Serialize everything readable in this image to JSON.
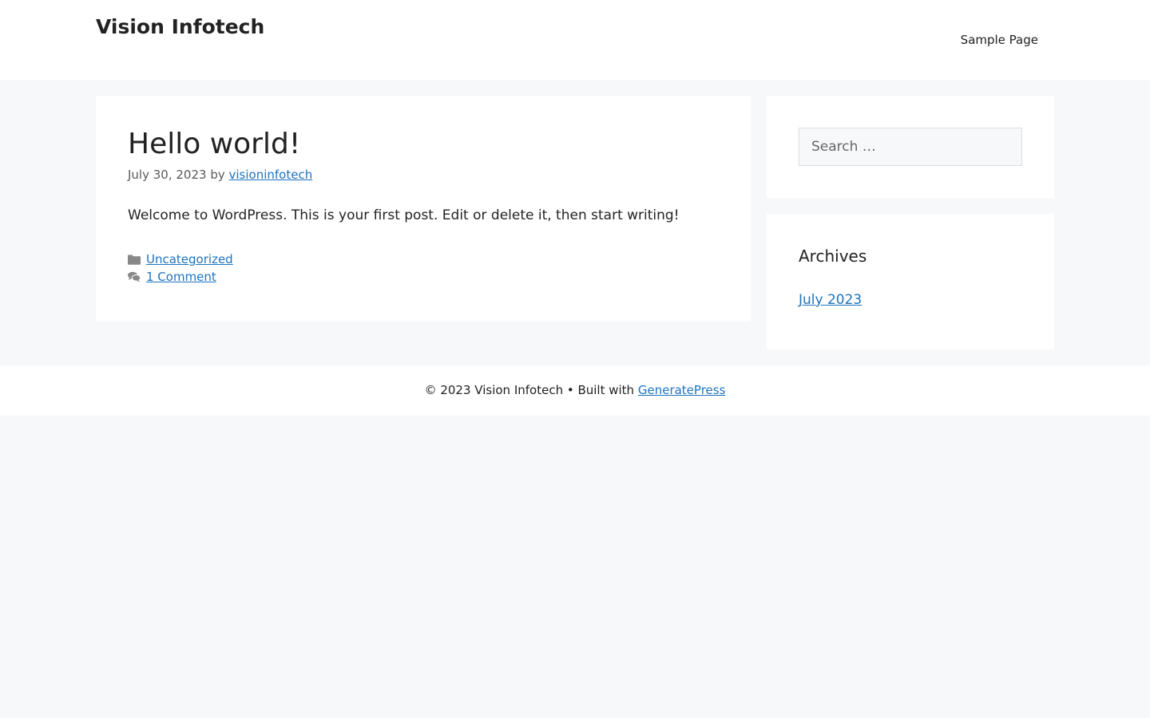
{
  "header": {
    "site_title": "Vision Infotech",
    "nav": [
      {
        "label": "Sample Page"
      }
    ]
  },
  "post": {
    "title": "Hello world!",
    "date": "July 30, 2023",
    "by_text": "by",
    "author": "visioninfotech",
    "content": "Welcome to WordPress. This is your first post. Edit or delete it, then start writing!",
    "category": "Uncategorized",
    "comments": "1 Comment",
    "icons": {
      "category": "folder-icon",
      "comments": "comments-icon"
    }
  },
  "sidebar": {
    "search": {
      "placeholder": "Search …"
    },
    "archives": {
      "title": "Archives",
      "items": [
        {
          "label": "July 2023"
        }
      ]
    }
  },
  "footer": {
    "copyright": "© 2023 Vision Infotech • Built with",
    "theme_link": "GeneratePress"
  },
  "colors": {
    "background": "#f7f8f9",
    "surface": "#ffffff",
    "text": "#222222",
    "link": "#1e73be",
    "meta": "#595959"
  }
}
